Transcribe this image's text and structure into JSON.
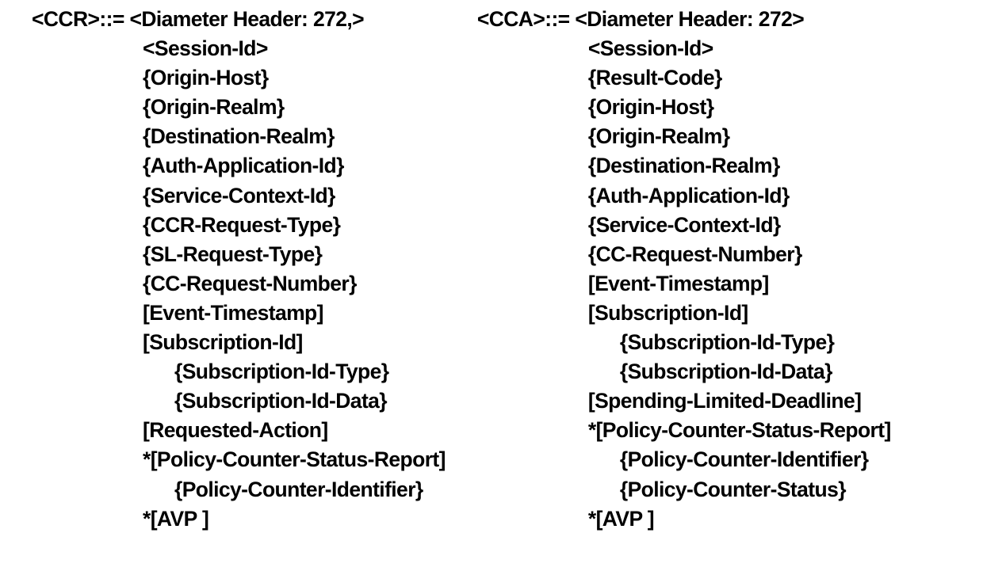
{
  "left": {
    "header_prefix": "<CCR>::= ",
    "header": "<Diameter Header: 272,>",
    "lines": [
      {
        "text": "<Session-Id>",
        "indent": 1
      },
      {
        "text": "{Origin-Host}",
        "indent": 1
      },
      {
        "text": "{Origin-Realm}",
        "indent": 1
      },
      {
        "text": "{Destination-Realm}",
        "indent": 1
      },
      {
        "text": "{Auth-Application-Id}",
        "indent": 1
      },
      {
        "text": "{Service-Context-Id}",
        "indent": 1
      },
      {
        "text": "{CCR-Request-Type}",
        "indent": 1
      },
      {
        "text": "{SL-Request-Type}",
        "indent": 1
      },
      {
        "text": "{CC-Request-Number}",
        "indent": 1
      },
      {
        "text": "[Event-Timestamp]",
        "indent": 1
      },
      {
        "text": "[Subscription-Id]",
        "indent": 1
      },
      {
        "text": "{Subscription-Id-Type}",
        "indent": 2
      },
      {
        "text": "{Subscription-Id-Data}",
        "indent": 2
      },
      {
        "text": "[Requested-Action]",
        "indent": 1
      },
      {
        "text": "*[Policy-Counter-Status-Report]",
        "indent": 1
      },
      {
        "text": "{Policy-Counter-Identifier}",
        "indent": 2
      },
      {
        "text": "*[AVP ]",
        "indent": 1
      }
    ]
  },
  "right": {
    "header_prefix": "<CCA>::= ",
    "header": "<Diameter Header: 272>",
    "lines": [
      {
        "text": "<Session-Id>",
        "indent": 1
      },
      {
        "text": "{Result-Code}",
        "indent": 1
      },
      {
        "text": "{Origin-Host}",
        "indent": 1
      },
      {
        "text": "{Origin-Realm}",
        "indent": 1
      },
      {
        "text": "{Destination-Realm}",
        "indent": 1
      },
      {
        "text": "{Auth-Application-Id}",
        "indent": 1
      },
      {
        "text": "{Service-Context-Id}",
        "indent": 1
      },
      {
        "text": "{CC-Request-Number}",
        "indent": 1
      },
      {
        "text": "[Event-Timestamp]",
        "indent": 1
      },
      {
        "text": "[Subscription-Id]",
        "indent": 1
      },
      {
        "text": "{Subscription-Id-Type}",
        "indent": 2
      },
      {
        "text": "{Subscription-Id-Data}",
        "indent": 2
      },
      {
        "text": "[Spending-Limited-Deadline]",
        "indent": 1
      },
      {
        "text": "*[Policy-Counter-Status-Report]",
        "indent": 1
      },
      {
        "text": "{Policy-Counter-Identifier}",
        "indent": 2
      },
      {
        "text": "{Policy-Counter-Status}",
        "indent": 2
      },
      {
        "text": "*[AVP ]",
        "indent": 1
      }
    ]
  }
}
